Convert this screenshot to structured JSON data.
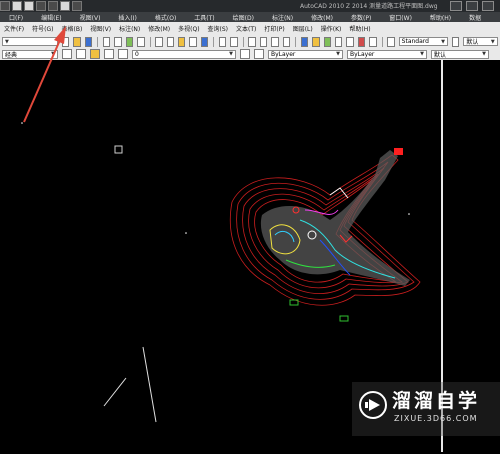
{
  "titlebar": {
    "app_title": "AutoCAD 2010   Z 2014 测量道路工程平面图.dwg"
  },
  "menubar": {
    "items": [
      "口(F)",
      "编辑(E)",
      "视图(V)",
      "插入(I)",
      "格式(O)",
      "工具(T)",
      "绘图(D)",
      "标注(N)",
      "修改(M)",
      "参数(P)",
      "窗口(W)",
      "帮助(H)",
      "数据"
    ]
  },
  "toolbar_menu": {
    "items": [
      "文件(F)",
      "符号(G)",
      "表格(B)",
      "视图(V)",
      "标注(N)",
      "修改(M)",
      "多视(Q)",
      "查询(S)",
      "文本(T)",
      "打印(P)",
      "图层(L)",
      "操作(K)",
      "帮助(H)"
    ]
  },
  "toolbar2": {
    "textstyle": "Standard",
    "dimstyle": "默认"
  },
  "toolbar3": {
    "workspace": "经典",
    "layer_name": "0",
    "color": "ByLayer",
    "linetype": "ByLayer",
    "lineweight": "默认"
  },
  "watermark": {
    "brand": "溜溜自学",
    "url": "ZIXUE.3D66.COM"
  },
  "colors": {
    "annotation_arrow": "#e0483a",
    "contour": "#d02020",
    "background": "#000000"
  }
}
